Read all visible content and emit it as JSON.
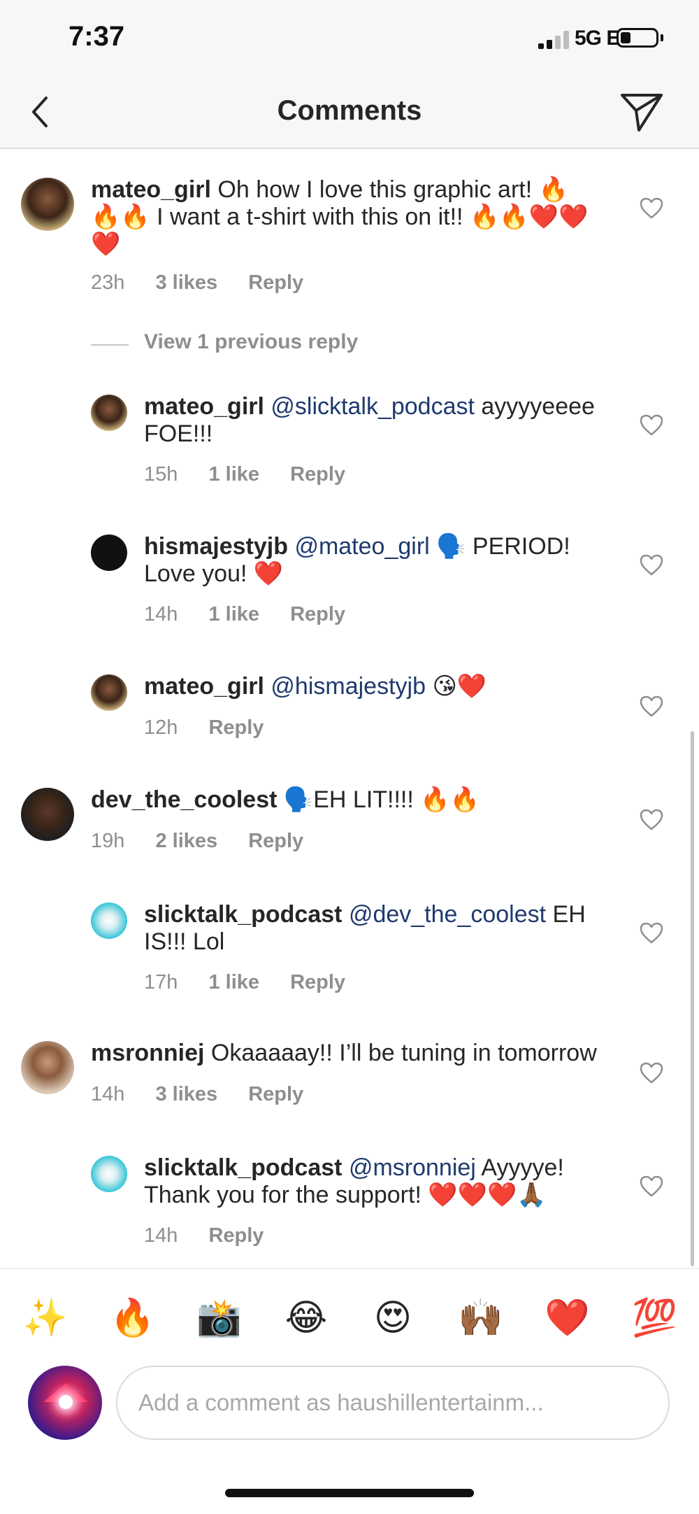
{
  "status_bar": {
    "time": "7:37",
    "network": "5G E"
  },
  "header": {
    "title": "Comments"
  },
  "view_previous": "View 1 previous reply",
  "comments": [
    {
      "user": "mateo_girl",
      "mention": "",
      "text": " Oh how I love this graphic art! 🔥🔥🔥 I want a t-shirt with this on it!! 🔥🔥❤️❤️❤️",
      "time": "23h",
      "likes": "3 likes",
      "reply": "Reply"
    },
    {
      "user": "mateo_girl",
      "mention": "@slicktalk_podcast",
      "text": " ayyyyeeee FOE!!!",
      "time": "15h",
      "likes": "1 like",
      "reply": "Reply"
    },
    {
      "user": "hismajestyjb",
      "mention": "@mateo_girl",
      "text": " 🗣️ PERIOD! Love you! ❤️",
      "time": "14h",
      "likes": "1 like",
      "reply": "Reply"
    },
    {
      "user": "mateo_girl",
      "mention": "@hismajestyjb",
      "text": " 😘❤️",
      "time": "12h",
      "likes": "",
      "reply": "Reply"
    },
    {
      "user": "dev_the_coolest",
      "mention": "",
      "text": " 🗣️EH LIT!!!! 🔥🔥",
      "time": "19h",
      "likes": "2 likes",
      "reply": "Reply"
    },
    {
      "user": "slicktalk_podcast",
      "mention": "@dev_the_coolest",
      "text": " EH IS!!! Lol",
      "time": "17h",
      "likes": "1 like",
      "reply": "Reply"
    },
    {
      "user": "msronniej",
      "mention": "",
      "text": " Okaaaaay!! I’ll be tuning in tomorrow",
      "time": "14h",
      "likes": "3 likes",
      "reply": "Reply"
    },
    {
      "user": "slicktalk_podcast",
      "mention": "@msronniej",
      "text": " Ayyyye! Thank you for the support! ❤️❤️❤️🙏🏾",
      "time": "14h",
      "likes": "",
      "reply": "Reply"
    }
  ],
  "emoji_bar": [
    "✨",
    "🔥",
    "📸",
    "😂",
    "😍",
    "🙌🏾",
    "❤️",
    "💯"
  ],
  "input": {
    "placeholder": "Add a comment as haushillentertainm..."
  },
  "colors": {
    "mention": "#1e3a6e",
    "meta": "#8e8e8e",
    "header_bg": "#f7f7f7"
  }
}
